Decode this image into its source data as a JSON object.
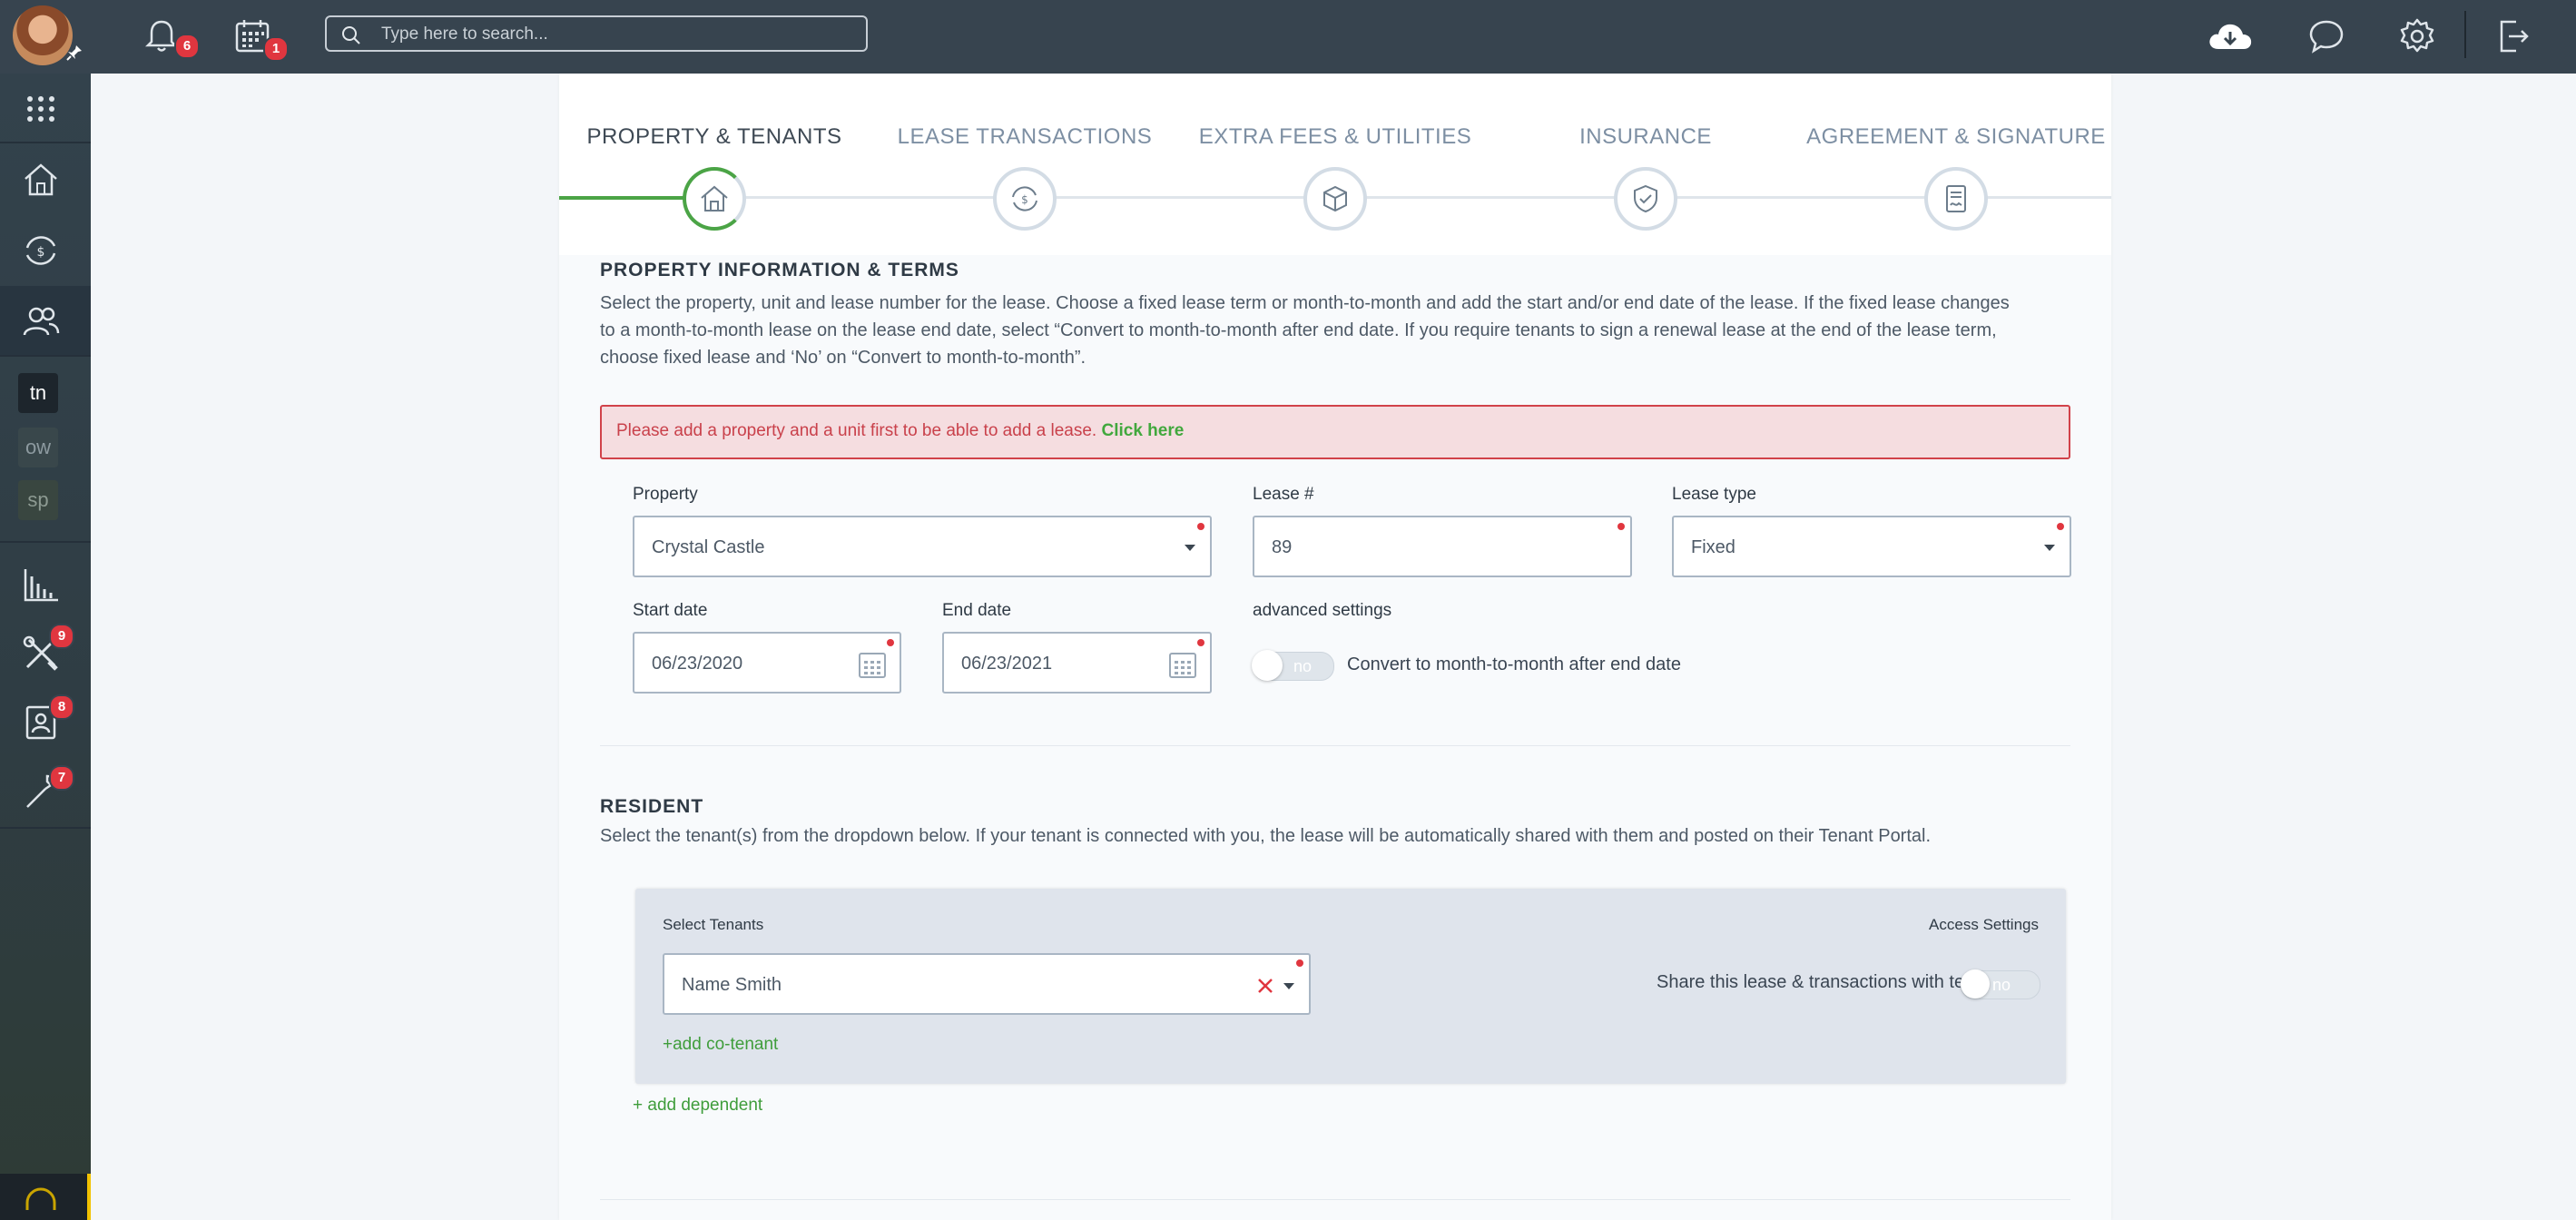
{
  "topbar": {
    "notifications_count": "6",
    "calendar_count": "1",
    "search_placeholder": "Type here to search..."
  },
  "sidebar": {
    "letters": [
      "tn",
      "ow",
      "sp"
    ],
    "badges": {
      "maintenance": "9",
      "contacts": "8",
      "tools": "7"
    }
  },
  "steps": [
    {
      "label": "PROPERTY & TENANTS",
      "icon": "house-icon",
      "active": true
    },
    {
      "label": "LEASE TRANSACTIONS",
      "icon": "money-cycle-icon",
      "active": false
    },
    {
      "label": "EXTRA FEES & UTILITIES",
      "icon": "box-icon",
      "active": false
    },
    {
      "label": "INSURANCE",
      "icon": "shield-icon",
      "active": false
    },
    {
      "label": "AGREEMENT & SIGNATURE",
      "icon": "document-sign-icon",
      "active": false
    }
  ],
  "property_section": {
    "title": "PROPERTY INFORMATION & TERMS",
    "desc_line1": "Select the property, unit and lease number for the lease. Choose a fixed lease term or month-to-month and add the start and/or end date of the lease. If the fixed lease changes",
    "desc_line2": "to a month-to-month lease on the lease end date, select “Convert to month-to-month after end date. If you require tenants to sign a renewal lease at the end of the lease term,",
    "desc_line3": "choose fixed lease and ‘No’ on “Convert to month-to-month”.",
    "alert_text": "Please add a property and a unit first to be able to add a lease.",
    "alert_link": "Click here"
  },
  "form": {
    "property_label": "Property",
    "property_value": "Crystal Castle",
    "lease_number_label": "Lease #",
    "lease_number_value": "89",
    "lease_type_label": "Lease type",
    "lease_type_value": "Fixed",
    "start_date_label": "Start date",
    "start_date_value": "06/23/2020",
    "end_date_label": "End date",
    "end_date_value": "06/23/2021",
    "advanced_label": "advanced settings",
    "convert_toggle_value": "no",
    "convert_label": "Convert to month-to-month after end date"
  },
  "resident_section": {
    "title": "RESIDENT",
    "desc": "Select the tenant(s) from the dropdown below. If your tenant is connected with you, the lease will be automatically shared with them and posted on their Tenant Portal.",
    "select_tenants_label": "Select Tenants",
    "access_settings_label": "Access Settings",
    "tenant_value": "Name Smith",
    "share_label": "Share this lease & transactions with tenant(s)",
    "share_toggle_value": "no",
    "add_cotenant": "+add co-tenant",
    "add_dependent": "+ add dependent"
  },
  "colors": {
    "topbar_bg": "#37444f",
    "accent_green": "#4ba446",
    "alert_red": "#d1424a",
    "badge_red": "#e0363f"
  }
}
